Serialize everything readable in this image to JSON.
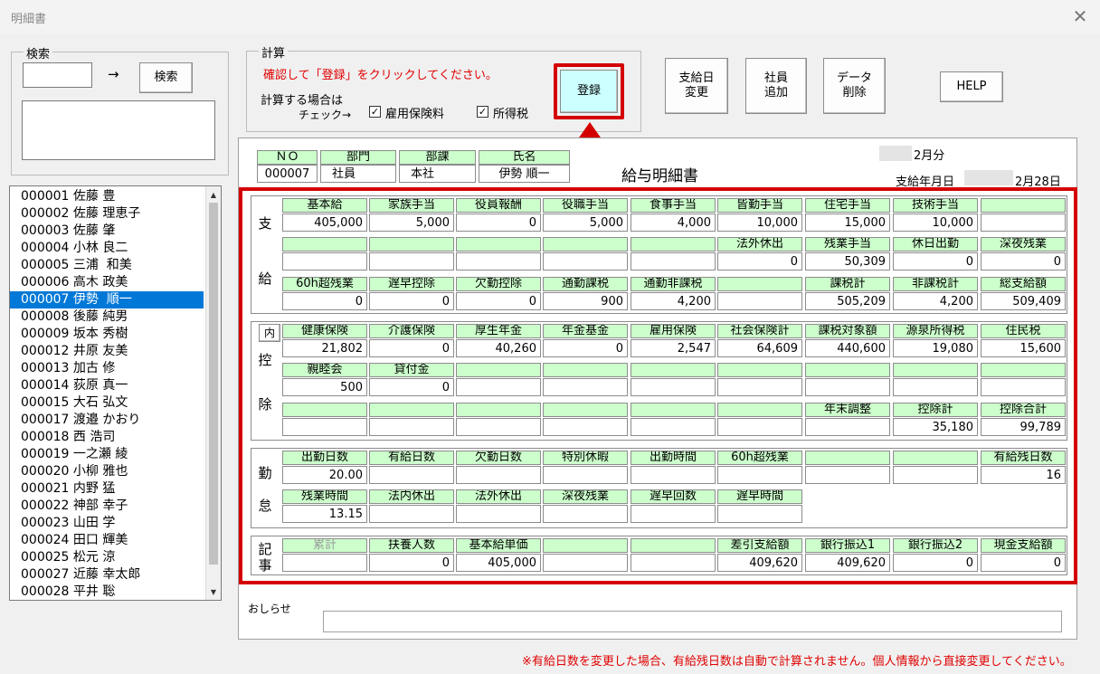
{
  "window": {
    "title": "明細書",
    "close": "✕"
  },
  "search": {
    "frame_label": "検索",
    "arrow": "→",
    "button": "検索",
    "input_value": ""
  },
  "employees": [
    {
      "id": "000001",
      "name": "佐藤 豊"
    },
    {
      "id": "000002",
      "name": "佐藤 理恵子"
    },
    {
      "id": "000003",
      "name": "佐藤 肇"
    },
    {
      "id": "000004",
      "name": "小林 良二"
    },
    {
      "id": "000005",
      "name": "三浦  和美"
    },
    {
      "id": "000006",
      "name": "高木 政美"
    },
    {
      "id": "000007",
      "name": "伊勢  順一",
      "selected": true
    },
    {
      "id": "000008",
      "name": "後藤 純男"
    },
    {
      "id": "000009",
      "name": "坂本 秀樹"
    },
    {
      "id": "000012",
      "name": "井原 友美"
    },
    {
      "id": "000013",
      "name": "加古 修"
    },
    {
      "id": "000014",
      "name": "荻原 真一"
    },
    {
      "id": "000015",
      "name": "大石 弘文"
    },
    {
      "id": "000017",
      "name": "渡邉 かおり"
    },
    {
      "id": "000018",
      "name": "西 浩司"
    },
    {
      "id": "000019",
      "name": "一之瀬 綾"
    },
    {
      "id": "000020",
      "name": "小柳 雅也"
    },
    {
      "id": "000021",
      "name": "内野 猛"
    },
    {
      "id": "000022",
      "name": "神部 幸子"
    },
    {
      "id": "000023",
      "name": "山田 学"
    },
    {
      "id": "000024",
      "name": "田口 輝美"
    },
    {
      "id": "000025",
      "name": "松元 涼"
    },
    {
      "id": "000027",
      "name": "近藤 幸太郎"
    },
    {
      "id": "000028",
      "name": "平井 聡"
    }
  ],
  "calc": {
    "frame_label": "計算",
    "instruction": "確認して「登録」をクリックしてください。",
    "check_line1": "計算する場合は",
    "check_line2": "チェック→",
    "employment_insurance": "雇用保険料",
    "income_tax": "所得税",
    "check_mark": "✓",
    "register_button": "登録"
  },
  "toolbar": {
    "paydate_change": "支給日\n変更",
    "add_employee": "社員\n追加",
    "delete_data": "データ\n削除",
    "help": "HELP"
  },
  "slip": {
    "header": {
      "no_label": "ＮＯ",
      "no_value": "000007",
      "dept_label": "部門",
      "dept_value": "社員",
      "section_label": "部課",
      "section_value": "本社",
      "name_label": "氏名",
      "name_value": "伊勢  順一"
    },
    "title": "給与明細書",
    "month": "2月分",
    "paydate_label": "支給年月日",
    "paydate_value": "2月28日",
    "pay": {
      "label_chars": [
        "支",
        "給"
      ],
      "rows": [
        {
          "headers": [
            "基本給",
            "家族手当",
            "役員報酬",
            "役職手当",
            "食事手当",
            "皆勤手当",
            "住宅手当",
            "技術手当",
            ""
          ],
          "values": [
            "405,000",
            "5,000",
            "0",
            "5,000",
            "4,000",
            "10,000",
            "15,000",
            "10,000",
            ""
          ]
        },
        {
          "headers": [
            "",
            "",
            "",
            "",
            "",
            "法外休出",
            "残業手当",
            "休日出勤",
            "深夜残業"
          ],
          "values": [
            "",
            "",
            "",
            "",
            "",
            "0",
            "50,309",
            "0",
            "0"
          ]
        },
        {
          "headers": [
            "60h超残業",
            "遅早控除",
            "欠勤控除",
            "通勤課税",
            "通勤非課税",
            "",
            "課税計",
            "非課税計",
            "総支給額"
          ],
          "values": [
            "0",
            "0",
            "0",
            "900",
            "4,200",
            "",
            "505,209",
            "4,200",
            "509,409"
          ]
        }
      ]
    },
    "deduct": {
      "label_chars": [
        "控",
        "除"
      ],
      "inner_button": "内",
      "rows": [
        {
          "headers": [
            "健康保険",
            "介護保険",
            "厚生年金",
            "年金基金",
            "雇用保険",
            "社会保険計",
            "課税対象額",
            "源泉所得税",
            "住民税"
          ],
          "values": [
            "21,802",
            "0",
            "40,260",
            "0",
            "2,547",
            "64,609",
            "440,600",
            "19,080",
            "15,600"
          ]
        },
        {
          "headers": [
            "親睦会",
            "貸付金",
            "",
            "",
            "",
            "",
            "",
            "",
            ""
          ],
          "values": [
            "500",
            "0",
            "",
            "",
            "",
            "",
            "",
            "",
            ""
          ]
        },
        {
          "headers": [
            "",
            "",
            "",
            "",
            "",
            "",
            "年末調整",
            "控除計",
            "控除合計"
          ],
          "values": [
            "",
            "",
            "",
            "",
            "",
            "",
            "",
            "35,180",
            "99,789"
          ]
        }
      ]
    },
    "attendance": {
      "label_chars": [
        "勤",
        "怠"
      ],
      "rows": [
        {
          "headers": [
            "出勤日数",
            "有給日数",
            "欠勤日数",
            "特別休暇",
            "出勤時間",
            "60h超残業",
            "",
            "",
            "有給残日数"
          ],
          "values": [
            "20.00",
            "",
            "",
            "",
            "",
            "",
            "",
            "",
            "16"
          ]
        },
        {
          "headers": [
            "残業時間",
            "法内休出",
            "法外休出",
            "深夜残業",
            "遅早回数",
            "遅早時間"
          ],
          "values": [
            "13.15",
            "",
            "",
            "",
            "",
            ""
          ]
        }
      ]
    },
    "notes": {
      "label_chars": [
        "記",
        "事"
      ],
      "rows": [
        {
          "headers": [
            "累計",
            "扶養人数",
            "基本給単価",
            "",
            "",
            "差引支給額",
            "銀行振込1",
            "銀行振込2",
            "現金支給額"
          ],
          "values": [
            "",
            "0",
            "405,000",
            "",
            "",
            "409,620",
            "409,620",
            "0",
            "0"
          ]
        }
      ]
    },
    "notice_label": "おしらせ",
    "notice_value": ""
  },
  "footer_warning": "※有給日数を変更した場合、有給残日数は自動で計算されません。個人情報から直接変更してください。",
  "colors": {
    "accent_red": "#d40000",
    "header_green": "#ccffcc",
    "selection_blue": "#0078d7"
  }
}
